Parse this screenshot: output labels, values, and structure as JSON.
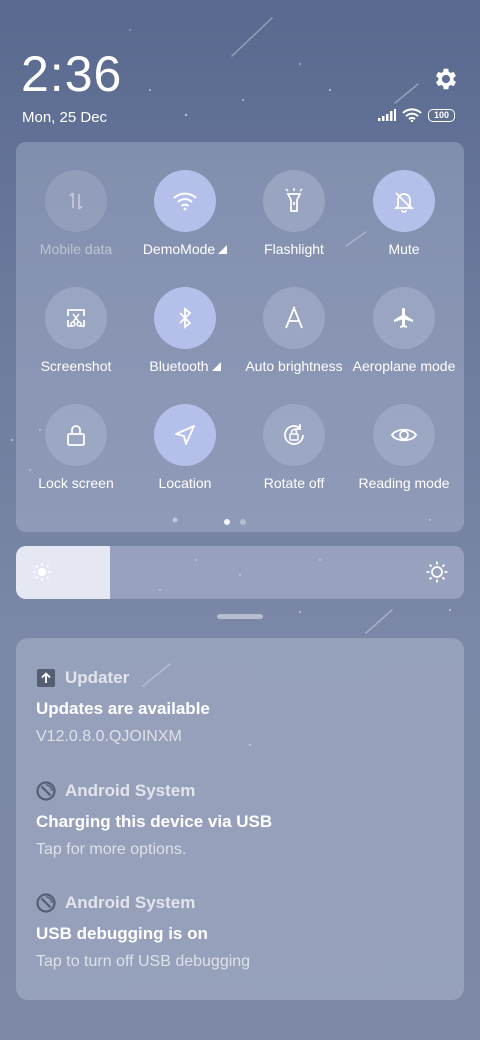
{
  "lockscreen": {
    "time": "2:36",
    "date": "Mon, 25 Dec"
  },
  "status_bar": {
    "battery": "100",
    "icons": [
      "signal-icon",
      "wifi-icon",
      "battery-icon"
    ]
  },
  "quick_settings": {
    "tiles": [
      {
        "label": "Mobile data",
        "icon": "mobile-data-icon",
        "state": "unavailable"
      },
      {
        "label": "DemoMode",
        "icon": "wifi-icon",
        "state": "on",
        "expand": true
      },
      {
        "label": "Flashlight",
        "icon": "flashlight-icon",
        "state": "off"
      },
      {
        "label": "Mute",
        "icon": "mute-icon",
        "state": "on"
      },
      {
        "label": "Screenshot",
        "icon": "screenshot-icon",
        "state": "off"
      },
      {
        "label": "Bluetooth",
        "icon": "bluetooth-icon",
        "state": "on",
        "expand": true
      },
      {
        "label": "Auto brightness",
        "icon": "auto-brightness-icon",
        "state": "off"
      },
      {
        "label": "Aeroplane mode",
        "icon": "aeroplane-icon",
        "state": "off"
      },
      {
        "label": "Lock screen",
        "icon": "lock-icon",
        "state": "off"
      },
      {
        "label": "Location",
        "icon": "location-icon",
        "state": "on"
      },
      {
        "label": "Rotate off",
        "icon": "rotate-lock-icon",
        "state": "off"
      },
      {
        "label": "Reading mode",
        "icon": "eye-icon",
        "state": "off"
      }
    ],
    "page_count": 2,
    "current_page": 1
  },
  "brightness": {
    "level": 0.21
  },
  "notifications": [
    {
      "app": "Updater",
      "icon": "updater-icon",
      "title": "Updates are available",
      "text": "V12.0.8.0.QJOINXM"
    },
    {
      "app": "Android System",
      "icon": "android-system-icon",
      "title": "Charging this device via USB",
      "text": "Tap for more options."
    },
    {
      "app": "Android System",
      "icon": "android-system-icon",
      "title": "USB debugging is on",
      "text": "Tap to turn off USB debugging"
    }
  ],
  "colors": {
    "accent_tile": "#b4bfea",
    "background_top": "#59698f",
    "background_bottom": "#7d89a6"
  }
}
